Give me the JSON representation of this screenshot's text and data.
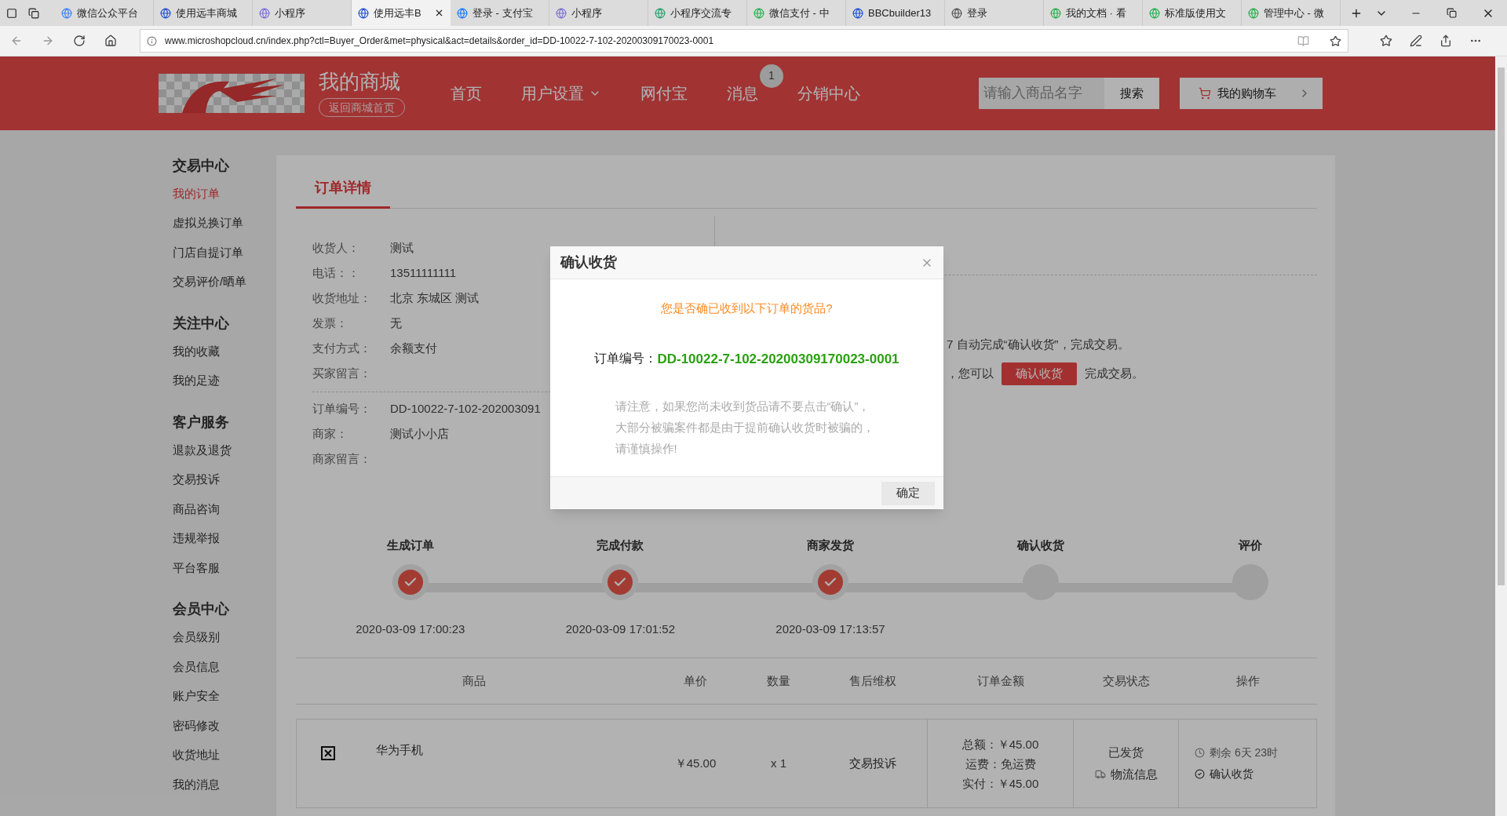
{
  "browser": {
    "tabs": [
      {
        "title": "微信公众平台",
        "selected": false
      },
      {
        "title": "使用远丰商城",
        "selected": false
      },
      {
        "title": "小程序",
        "selected": false
      },
      {
        "title": "使用远丰B",
        "selected": true
      },
      {
        "title": "登录 - 支付宝",
        "selected": false
      },
      {
        "title": "小程序",
        "selected": false
      },
      {
        "title": "小程序交流专",
        "selected": false
      },
      {
        "title": "微信支付 - 中",
        "selected": false
      },
      {
        "title": "BBCbuilder13",
        "selected": false
      },
      {
        "title": "登录",
        "selected": false
      },
      {
        "title": "我的文档 · 看",
        "selected": false
      },
      {
        "title": "标准版使用文",
        "selected": false
      },
      {
        "title": "管理中心 - 微",
        "selected": false
      }
    ],
    "url": "www.microshopcloud.cn/index.php?ctl=Buyer_Order&met=physical&act=details&order_id=DD-10022-7-102-20200309170023-0001"
  },
  "header": {
    "store_name": "我的商城",
    "home_link": "返回商城首页",
    "nav": [
      {
        "label": "首页",
        "kind": "plain"
      },
      {
        "label": "用户设置",
        "kind": "dropdown"
      },
      {
        "label": "网付宝",
        "kind": "plain"
      },
      {
        "label": "消息",
        "kind": "badge",
        "badge": "1"
      },
      {
        "label": "分销中心",
        "kind": "plain"
      }
    ],
    "search": {
      "placeholder": "请输入商品名字",
      "button": "搜索"
    },
    "cart_button": "我的购物车"
  },
  "sidebar": {
    "sections": [
      {
        "title": "交易中心",
        "items": [
          {
            "label": "我的订单",
            "selected": true
          },
          {
            "label": "虚拟兑换订单",
            "selected": false
          },
          {
            "label": "门店自提订单",
            "selected": false
          },
          {
            "label": "交易评价/晒单",
            "selected": false
          }
        ]
      },
      {
        "title": "关注中心",
        "items": [
          {
            "label": "我的收藏",
            "selected": false
          },
          {
            "label": "我的足迹",
            "selected": false
          }
        ]
      },
      {
        "title": "客户服务",
        "items": [
          {
            "label": "退款及退货",
            "selected": false
          },
          {
            "label": "交易投诉",
            "selected": false
          },
          {
            "label": "商品咨询",
            "selected": false
          },
          {
            "label": "违规举报",
            "selected": false
          },
          {
            "label": "平台客服",
            "selected": false
          }
        ]
      },
      {
        "title": "会员中心",
        "items": [
          {
            "label": "会员级别",
            "selected": false
          },
          {
            "label": "会员信息",
            "selected": false
          },
          {
            "label": "账户安全",
            "selected": false
          },
          {
            "label": "密码修改",
            "selected": false
          },
          {
            "label": "收货地址",
            "selected": false
          },
          {
            "label": "我的消息",
            "selected": false
          }
        ]
      }
    ]
  },
  "order": {
    "tab": "订单详情",
    "receiver_info": [
      {
        "label": "收货人：",
        "value": "测试"
      },
      {
        "label": "电话：：",
        "value": "13511111111"
      },
      {
        "label": "收货地址：",
        "value": "北京 东城区 测试"
      },
      {
        "label": "发票：",
        "value": "无"
      },
      {
        "label": "支付方式：",
        "value": "余额支付"
      },
      {
        "label": "买家留言："
      }
    ],
    "order_info": [
      {
        "label": "订单编号：",
        "value": "DD-10022-7-102-202003091"
      },
      {
        "label": "商家：",
        "value": "测试小小店"
      },
      {
        "label": "商家留言："
      }
    ],
    "notice": {
      "line_1": "7  自动完成“确认收货”，完成交易。",
      "line_2_prefix": "，您可以",
      "button": "确认收货",
      "line_2_suffix": "完成交易。"
    },
    "steps": [
      {
        "label": "生成订单",
        "done": true,
        "time": "2020-03-09 17:00:23"
      },
      {
        "label": "完成付款",
        "done": true,
        "time": "2020-03-09 17:01:52"
      },
      {
        "label": "商家发货",
        "done": true,
        "time": "2020-03-09 17:13:57"
      },
      {
        "label": "确认收货",
        "done": false
      },
      {
        "label": "评价",
        "done": false
      }
    ],
    "table": {
      "columns": [
        "商品",
        "单价",
        "数量",
        "售后维权",
        "订单金额",
        "交易状态",
        "操作"
      ],
      "rows": [
        {
          "product": "华为手机",
          "price": "￥45.00",
          "quantity": "x 1",
          "after_sale": "交易投诉",
          "amounts": [
            "总额：￥45.00",
            "运费：免运费",
            "实付：￥45.00"
          ],
          "status": "已发货",
          "logistics": "物流信息",
          "remaining": "剩余 6天 23时",
          "confirm": "确认收货"
        }
      ]
    }
  },
  "dialog": {
    "title": "确认收货",
    "question": "您是否确已收到以下订单的货品?",
    "order_label": "订单编号：",
    "order_number": "DD-10022-7-102-20200309170023-0001",
    "warning": "请注意，如果您尚未收到货品请不要点击“确认”，大部分被骗案件都是由于提前确认收货时被骗的，请谨慎操作!",
    "ok_button": "确定"
  }
}
